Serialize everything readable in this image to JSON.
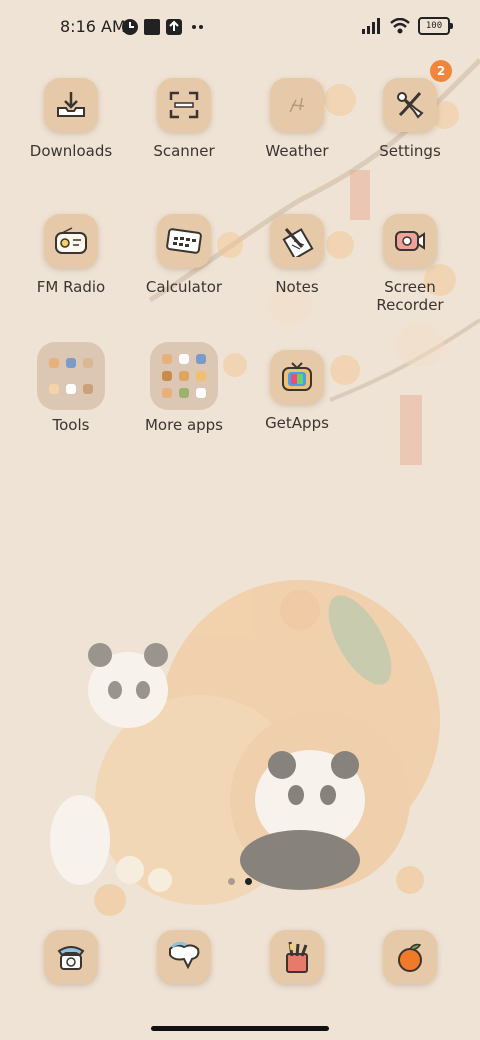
{
  "status_bar": {
    "time": "8:16 AM",
    "battery": "100",
    "icons": [
      "app-status-icon",
      "square-notification-icon",
      "upload-notification-icon",
      "more-dots-icon",
      "signal-icon",
      "wifi-icon",
      "battery-icon"
    ]
  },
  "grid": [
    {
      "label": "Downloads",
      "icon": "download-tray-icon"
    },
    {
      "label": "Scanner",
      "icon": "scan-frame-icon"
    },
    {
      "label": "Weather",
      "icon": "weather-sketch-icon"
    },
    {
      "label": "Settings",
      "icon": "wrench-tools-icon",
      "badge": "2"
    },
    {
      "label": "FM Radio",
      "icon": "radio-icon"
    },
    {
      "label": "Calculator",
      "icon": "calculator-icon"
    },
    {
      "label": "Notes",
      "icon": "notes-pen-icon"
    },
    {
      "label": "Screen\nRecorder",
      "icon": "screen-recorder-icon"
    }
  ],
  "folders": [
    {
      "label": "Tools"
    },
    {
      "label": "More apps"
    }
  ],
  "getapps": {
    "label": "GetApps",
    "icon": "getapps-tv-icon"
  },
  "page_indicator": {
    "pages": 2,
    "active": 2
  },
  "dock": [
    {
      "icon": "phone-icon"
    },
    {
      "icon": "messages-icon"
    },
    {
      "icon": "pencil-cup-icon"
    },
    {
      "icon": "orange-fruit-icon"
    }
  ],
  "colors": {
    "badge": "#f0863b",
    "icon_bg": "#e5c9a8",
    "wallpaper": "#efe3d5"
  }
}
